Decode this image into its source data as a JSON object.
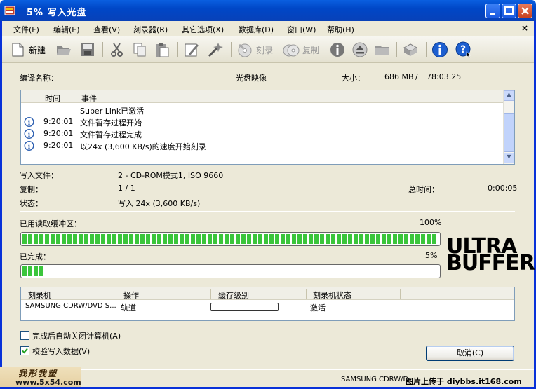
{
  "window": {
    "title": "5% 写入光盘"
  },
  "menu": {
    "items": [
      "文件(F)",
      "编辑(E)",
      "查看(V)",
      "刻录器(R)",
      "其它选项(X)",
      "数据库(D)",
      "窗口(W)",
      "帮助(H)"
    ],
    "close_label": "×"
  },
  "toolbar": {
    "new_label": "新建",
    "burn_label": "刻录",
    "copy_label": "复制"
  },
  "compile": {
    "name_label": "编译名称：",
    "name_value": "光盘映像",
    "size_label": "大小：",
    "size_mb": "686 MB",
    "size_sep": "/",
    "size_time": "78:03.25"
  },
  "log": {
    "columns": [
      "时间",
      "事件"
    ],
    "rows": [
      {
        "time": "",
        "event": "Super Link已激活",
        "icon": ""
      },
      {
        "time": "9:20:01",
        "event": "文件暂存过程开始",
        "icon": "info-icon"
      },
      {
        "time": "9:20:01",
        "event": "文件暂存过程完成",
        "icon": "info-icon"
      },
      {
        "time": "9:20:01",
        "event": "以24x (3,600 KB/s)的速度开始刻录",
        "icon": "info-icon"
      }
    ]
  },
  "details": {
    "write_file_label": "写入文件：",
    "write_file_value": "2 - CD-ROM模式1, ISO 9660",
    "copy_label": "复制：",
    "copy_value": "1 / 1",
    "total_time_label": "总时间：",
    "total_time_value": "0:00:05",
    "status_label": "状态：",
    "status_value": "写入 24x (3,600 KB/s)"
  },
  "buffer": {
    "label": "已用读取缓冲区：",
    "percent_text": "100%",
    "fraction": 1.0
  },
  "completed": {
    "label": "已完成：",
    "percent_text": "5%",
    "fraction": 0.05
  },
  "logo": {
    "line1": "ULTRA",
    "line2": "BUFFER"
  },
  "recorders": {
    "columns": [
      "刻录机",
      "操作",
      "缓存级别",
      "刻录机状态"
    ],
    "rows": [
      {
        "recorder": "SAMSUNG CDRW/DVD S...",
        "operation": "轨道",
        "buffer_fraction": 0.0,
        "state": "激活"
      }
    ]
  },
  "options": {
    "shutdown_label": "完成后自动关闭计算机(A)",
    "shutdown_checked": false,
    "verify_label": "校验写入数据(V)",
    "verify_checked": true
  },
  "cancel_label": "取消(C)",
  "statusbar": {
    "left_wm1": "我形我塑",
    "left_wm2": "www.5x54.com",
    "device": "SAMSUNG",
    "device2": "CDRW/D",
    "right_wm": "图片上传于 diybbs.it168.com"
  },
  "colors": {
    "titlebar": "#0047c7",
    "progress_green": "#3bc53b",
    "panel": "#ece9d8"
  }
}
